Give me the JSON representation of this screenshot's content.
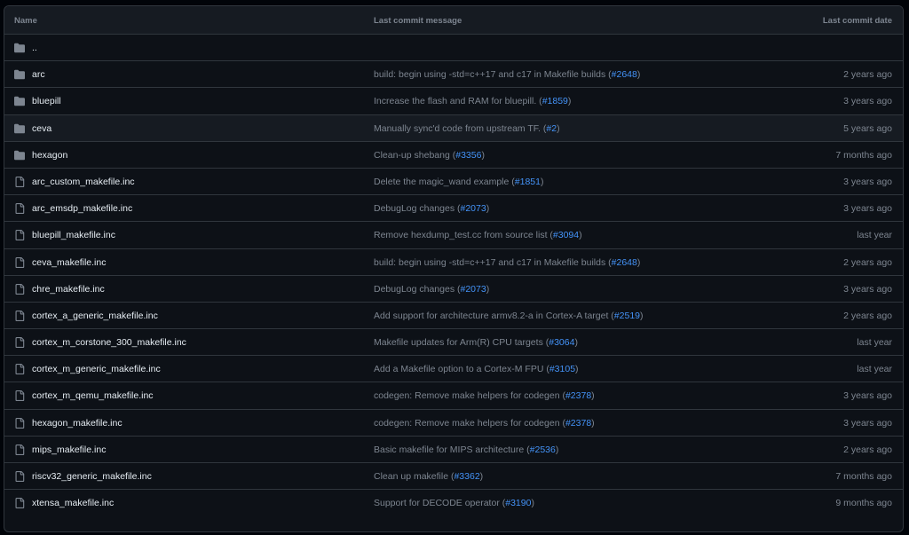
{
  "header": {
    "name": "Name",
    "message": "Last commit message",
    "date": "Last commit date"
  },
  "parent": {
    "name": ".."
  },
  "rows": [
    {
      "type": "folder",
      "name": "arc",
      "msg": "build: begin using -std=c++17 and c17 in Makefile builds (",
      "pr": "#2648",
      "close": ")",
      "date": "2 years ago"
    },
    {
      "type": "folder",
      "name": "bluepill",
      "msg": "Increase the flash and RAM for bluepill. (",
      "pr": "#1859",
      "close": ")",
      "date": "3 years ago"
    },
    {
      "type": "folder",
      "name": "ceva",
      "msg": "Manually sync'd code from upstream TF. (",
      "pr": "#2",
      "close": ")",
      "date": "5 years ago"
    },
    {
      "type": "folder",
      "name": "hexagon",
      "msg": "Clean-up shebang (",
      "pr": "#3356",
      "close": ")",
      "date": "7 months ago"
    },
    {
      "type": "file",
      "name": "arc_custom_makefile.inc",
      "msg": "Delete the magic_wand example (",
      "pr": "#1851",
      "close": ")",
      "date": "3 years ago"
    },
    {
      "type": "file",
      "name": "arc_emsdp_makefile.inc",
      "msg": "DebugLog changes (",
      "pr": "#2073",
      "close": ")",
      "date": "3 years ago"
    },
    {
      "type": "file",
      "name": "bluepill_makefile.inc",
      "msg": "Remove hexdump_test.cc from source list (",
      "pr": "#3094",
      "close": ")",
      "date": "last year"
    },
    {
      "type": "file",
      "name": "ceva_makefile.inc",
      "msg": "build: begin using -std=c++17 and c17 in Makefile builds (",
      "pr": "#2648",
      "close": ")",
      "date": "2 years ago"
    },
    {
      "type": "file",
      "name": "chre_makefile.inc",
      "msg": "DebugLog changes (",
      "pr": "#2073",
      "close": ")",
      "date": "3 years ago"
    },
    {
      "type": "file",
      "name": "cortex_a_generic_makefile.inc",
      "msg": "Add support for architecture armv8.2-a in Cortex-A target (",
      "pr": "#2519",
      "close": ")",
      "date": "2 years ago"
    },
    {
      "type": "file",
      "name": "cortex_m_corstone_300_makefile.inc",
      "msg": "Makefile updates for Arm(R) CPU targets (",
      "pr": "#3064",
      "close": ")",
      "date": "last year"
    },
    {
      "type": "file",
      "name": "cortex_m_generic_makefile.inc",
      "msg": "Add a Makefile option to a Cortex-M FPU (",
      "pr": "#3105",
      "close": ")",
      "date": "last year"
    },
    {
      "type": "file",
      "name": "cortex_m_qemu_makefile.inc",
      "msg": "codegen: Remove make helpers for codegen (",
      "pr": "#2378",
      "close": ")",
      "date": "3 years ago"
    },
    {
      "type": "file",
      "name": "hexagon_makefile.inc",
      "msg": "codegen: Remove make helpers for codegen (",
      "pr": "#2378",
      "close": ")",
      "date": "3 years ago"
    },
    {
      "type": "file",
      "name": "mips_makefile.inc",
      "msg": "Basic makefile for MIPS architecture (",
      "pr": "#2536",
      "close": ")",
      "date": "2 years ago"
    },
    {
      "type": "file",
      "name": "riscv32_generic_makefile.inc",
      "msg": "Clean up makefile (",
      "pr": "#3362",
      "close": ")",
      "date": "7 months ago"
    },
    {
      "type": "file",
      "name": "xtensa_makefile.inc",
      "msg": "Support for DECODE operator (",
      "pr": "#3190",
      "close": ")",
      "date": "9 months ago"
    }
  ],
  "colors": {
    "background": "#010409",
    "table_bg": "#0d1117",
    "border": "#30363d",
    "text": "#e6edf3",
    "muted": "#7d8590",
    "link": "#4493f8",
    "icon": "#7d8590"
  }
}
